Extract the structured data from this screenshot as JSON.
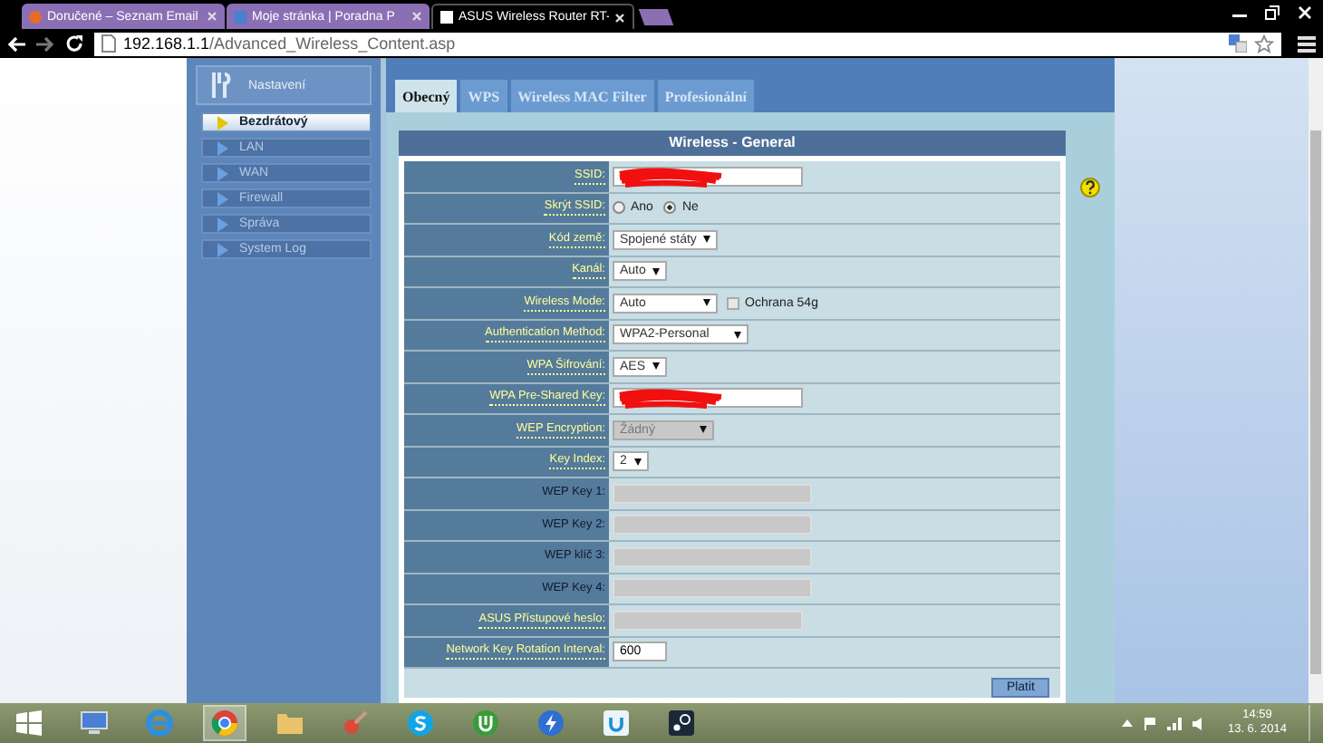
{
  "browser": {
    "tabs": [
      {
        "title": "Doručené – Seznam Email",
        "selected": false
      },
      {
        "title": "Moje stránka | Poradna P",
        "selected": false
      },
      {
        "title": "ASUS Wireless Router RT-",
        "selected": true
      }
    ],
    "url_host": "192.168.1.1",
    "url_path": "/Advanced_Wireless_Content.asp"
  },
  "sidebar": {
    "title": "Nastavení",
    "items": [
      {
        "label": "Bezdrátový",
        "selected": true
      },
      {
        "label": "LAN",
        "selected": false
      },
      {
        "label": "WAN",
        "selected": false
      },
      {
        "label": "Firewall",
        "selected": false
      },
      {
        "label": "Správa",
        "selected": false
      },
      {
        "label": "System Log",
        "selected": false
      }
    ]
  },
  "tabs": [
    {
      "label": "Obecný",
      "selected": true
    },
    {
      "label": "WPS",
      "selected": false
    },
    {
      "label": "Wireless MAC Filter",
      "selected": false
    },
    {
      "label": "Profesionální",
      "selected": false
    }
  ],
  "section_title": "Wireless - General",
  "rows": [
    {
      "label": "SSID:",
      "help": true,
      "kind": "text",
      "redacted": true,
      "disabled": false
    },
    {
      "label": "Skrýt SSID:",
      "help": true,
      "kind": "radio",
      "options": [
        {
          "label": "Ano",
          "selected": false
        },
        {
          "label": "Ne",
          "selected": true
        }
      ]
    },
    {
      "label": "Kód země:",
      "help": true,
      "kind": "select",
      "value": "Spojené státy",
      "disabled": false
    },
    {
      "label": "Kanál:",
      "help": true,
      "kind": "select",
      "value": "Auto",
      "disabled": false
    },
    {
      "label": "Wireless Mode:",
      "help": true,
      "kind": "select",
      "value": "Auto",
      "disabled": false,
      "checkbox": {
        "label": "Ochrana 54g",
        "checked": false
      }
    },
    {
      "label": "Authentication Method:",
      "help": true,
      "kind": "select",
      "value": "WPA2-Personal",
      "disabled": false
    },
    {
      "label": "WPA Šifrování:",
      "help": true,
      "kind": "select",
      "value": "AES",
      "disabled": false
    },
    {
      "label": "WPA Pre-Shared Key:",
      "help": true,
      "kind": "text",
      "redacted": true,
      "disabled": false
    },
    {
      "label": "WEP Encryption:",
      "help": true,
      "kind": "select",
      "value": "Žádný",
      "disabled": true
    },
    {
      "label": "Key Index:",
      "help": true,
      "kind": "select",
      "value": "2",
      "disabled": false
    },
    {
      "label": "WEP Key 1:",
      "help": false,
      "kind": "text",
      "disabled": true
    },
    {
      "label": "WEP Key 2:",
      "help": false,
      "kind": "text",
      "disabled": true
    },
    {
      "label": "WEP klíč 3:",
      "help": false,
      "kind": "text",
      "disabled": true
    },
    {
      "label": "WEP Key 4:",
      "help": false,
      "kind": "text",
      "disabled": true
    },
    {
      "label": "ASUS Přístupové heslo:",
      "help": true,
      "kind": "text",
      "disabled": true
    },
    {
      "label": "Network Key Rotation Interval:",
      "help": true,
      "kind": "text",
      "value": "600",
      "disabled": false
    }
  ],
  "apply_button": "Platit",
  "taskbar": {
    "time": "14:59",
    "date": "13. 6. 2014"
  }
}
